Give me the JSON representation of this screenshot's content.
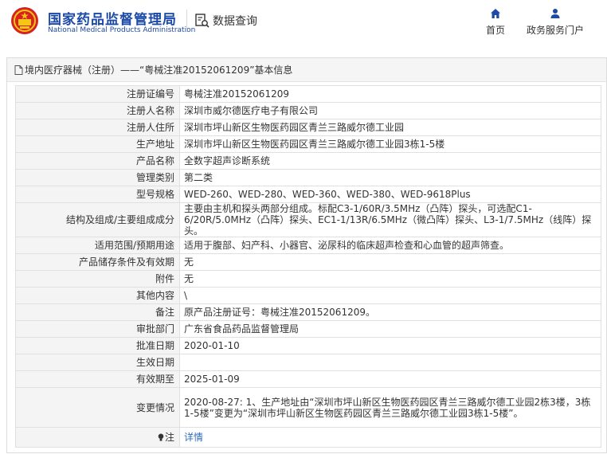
{
  "header": {
    "brand_cn": "国家药品监督管理局",
    "brand_en": "National Medical Products Administration",
    "query_label": "数据查询",
    "nav": {
      "home": "首页",
      "portal": "政务服务门户"
    },
    "colors": {
      "brand": "#1c4aa6",
      "emblem_red": "#d6231e",
      "emblem_gold": "#f5c518"
    }
  },
  "panel": {
    "title": "境内医疗器械（注册）——“粤械注准20152061209”基本信息",
    "rows": [
      {
        "label": "注册证编号",
        "value": "粤械注准20152061209"
      },
      {
        "label": "注册人名称",
        "value": "深圳市威尔德医疗电子有限公司"
      },
      {
        "label": "注册人住所",
        "value": "深圳市坪山新区生物医药园区青兰三路威尔德工业园"
      },
      {
        "label": "生产地址",
        "value": "深圳市坪山新区生物医药园区青兰三路威尔德工业园3栋1-5楼"
      },
      {
        "label": "产品名称",
        "value": "全数字超声诊断系统"
      },
      {
        "label": "管理类别",
        "value": "第二类"
      },
      {
        "label": "型号规格",
        "value": "WED-260、WED-280、WED-360、WED-380、WED-9618Plus"
      },
      {
        "label": "结构及组成/主要组成成分",
        "value": "主要由主机和探头两部分组成。标配C3-1/60R/3.5MHz（凸阵）探头，可选配C1-6/20R/5.0MHz（凸阵）探头、EC1-1/13R/6.5MHz（微凸阵）探头、L3-1/7.5MHz（线阵）探头。"
      },
      {
        "label": "适用范围/预期用途",
        "value": "适用于腹部、妇产科、小器官、泌尿科的临床超声检查和心血管的超声筛查。"
      },
      {
        "label": "产品储存条件及有效期",
        "value": "无"
      },
      {
        "label": "附件",
        "value": "无"
      },
      {
        "label": "其他内容",
        "value": "\\"
      },
      {
        "label": "备注",
        "value": "原产品注册证号：粤械注准20152061209。"
      },
      {
        "label": "审批部门",
        "value": "广东省食品药品监督管理局"
      },
      {
        "label": "批准日期",
        "value": "2020-01-10"
      },
      {
        "label": "生效日期",
        "value": ""
      },
      {
        "label": "有效期至",
        "value": "2025-01-09"
      },
      {
        "label": "变更情况",
        "value": "2020-08-27: 1、生产地址由“深圳市坪山新区生物医药园区青兰三路威尔德工业园2栋3楼，3栋1-5楼”变更为“深圳市坪山新区生物医药园区青兰三路威尔德工业园3栋1-5楼”。"
      },
      {
        "label": "注",
        "value": "详情"
      }
    ]
  }
}
